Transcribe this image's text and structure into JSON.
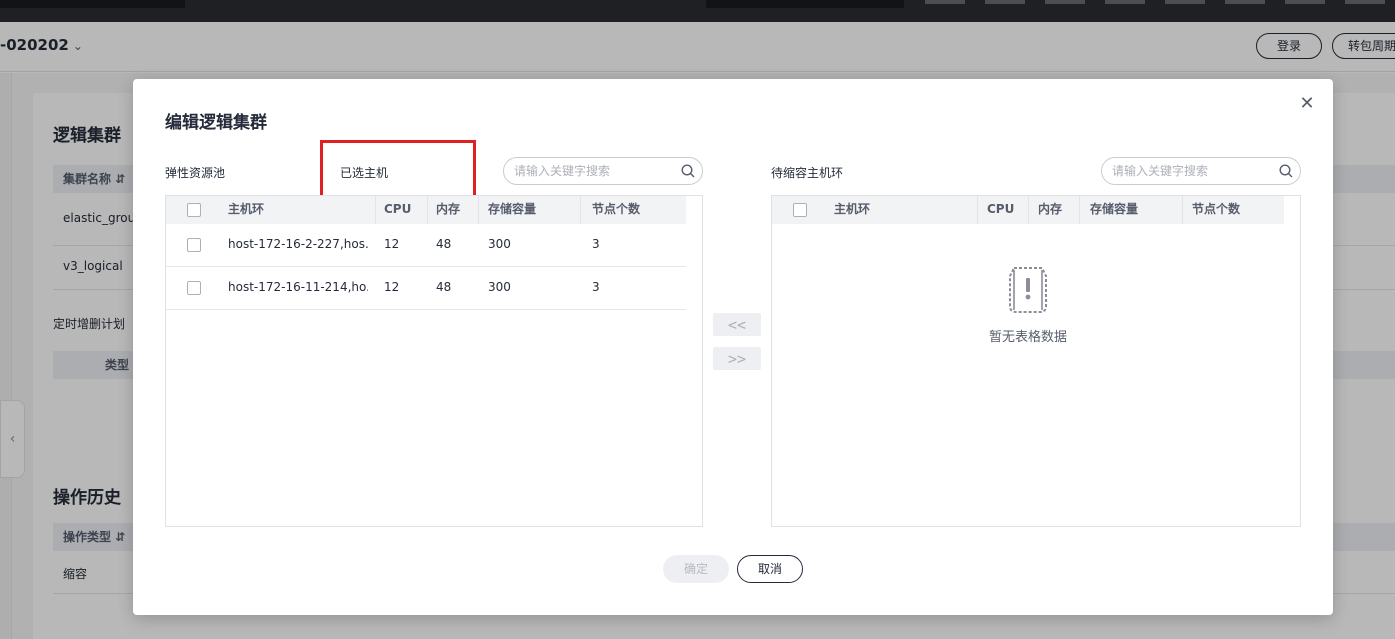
{
  "background": {
    "instance_title": "-020202",
    "login_button": "登录",
    "renew_button": "转包周期",
    "section_logical_cluster": "逻辑集群",
    "col_cluster_name": "集群名称",
    "cluster_rows": [
      "elastic_group",
      "v3_logical"
    ],
    "scheduled_plan": "定时增删计划",
    "col_type": "类型",
    "section_history": "操作历史",
    "col_operation_type": "操作类型",
    "history_rows": [
      "缩容"
    ]
  },
  "modal": {
    "title": "编辑逻辑集群",
    "left": {
      "pool_label": "弹性资源池",
      "selected_label": "已选主机",
      "search_placeholder": "请输入关键字搜索",
      "columns": [
        "主机环",
        "CPU",
        "内存",
        "存储容量",
        "节点个数"
      ],
      "rows": [
        {
          "ring": "host-172-16-2-227,hos...",
          "cpu": "12",
          "memory": "48",
          "storage": "300",
          "nodes": "3"
        },
        {
          "ring": "host-172-16-11-214,ho...",
          "cpu": "12",
          "memory": "48",
          "storage": "300",
          "nodes": "3"
        }
      ]
    },
    "right": {
      "label": "待缩容主机环",
      "search_placeholder": "请输入关键字搜索",
      "columns": [
        "主机环",
        "CPU",
        "内存",
        "存储容量",
        "节点个数"
      ],
      "empty_text": "暂无表格数据"
    },
    "move_left": "<<",
    "move_right": ">>",
    "ok_button": "确定",
    "cancel_button": "取消"
  }
}
